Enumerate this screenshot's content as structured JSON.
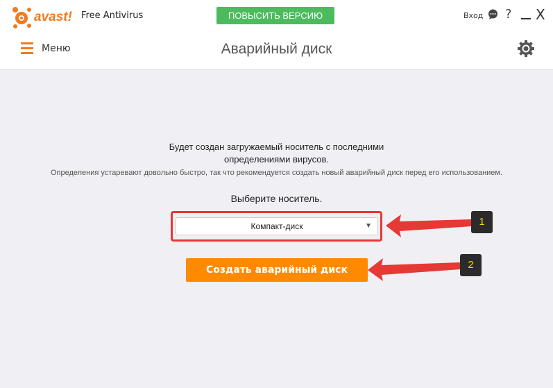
{
  "header": {
    "logo_text": "avast!",
    "product": "Free Antivirus",
    "upgrade_label": "ПОВЫСИТЬ ВЕРСИЮ",
    "login": "Вход",
    "help": "?",
    "close": "X"
  },
  "nav": {
    "menu_label": "Меню",
    "page_title": "Аварийный диск"
  },
  "main": {
    "line1": "Будет создан загружаемый носитель с последними",
    "line1b": "определениями вирусов.",
    "line2": "Определения устаревают довольно быстро, так что рекомендуется создать новый аварийный диск перед его использованием.",
    "choose_label": "Выберите носитель.",
    "media_selected": "Компакт-диск",
    "create_label": "Создать аварийный диск"
  },
  "annotations": {
    "badge1": "1",
    "badge2": "2",
    "color": "#e53935"
  },
  "colors": {
    "accent": "#f37a1f",
    "upgrade": "#4cbb5d",
    "create": "#ff8a00"
  }
}
